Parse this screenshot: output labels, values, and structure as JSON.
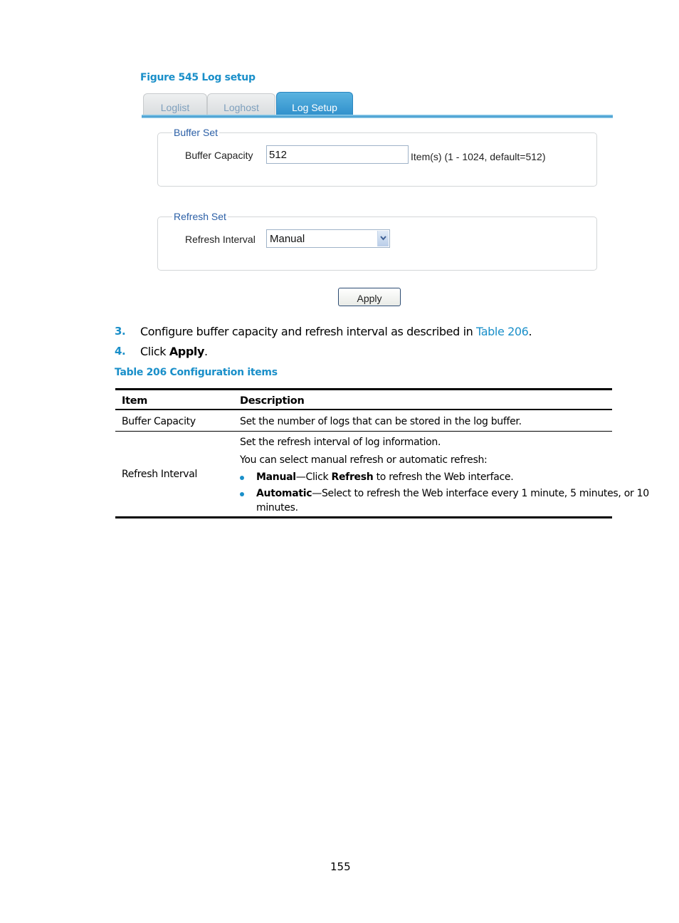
{
  "figure": {
    "caption": "Figure 545 Log setup",
    "tabs": [
      {
        "label": "Loglist",
        "active": false
      },
      {
        "label": "Loghost",
        "active": false
      },
      {
        "label": "Log Setup",
        "active": true
      }
    ],
    "buffer_set": {
      "legend": "Buffer Set",
      "field_label": "Buffer Capacity",
      "value": "512",
      "hint": "Item(s) (1 - 1024, default=512)"
    },
    "refresh_set": {
      "legend": "Refresh Set",
      "field_label": "Refresh Interval",
      "selected": "Manual",
      "arrow_icon": "chevron-down-icon"
    },
    "apply_label": "Apply"
  },
  "steps": [
    {
      "num": "3.",
      "text_before": "Configure buffer capacity and refresh interval as described in ",
      "link": "Table 206",
      "text_after": "."
    },
    {
      "num": "4.",
      "text_before": "Click ",
      "bold": "Apply",
      "text_after": "."
    }
  ],
  "table": {
    "caption": "Table 206 Configuration items",
    "headers": [
      "Item",
      "Description"
    ],
    "rows": [
      {
        "item": "Buffer Capacity",
        "description": [
          "Set the number of logs that can be stored in the log buffer."
        ]
      },
      {
        "item": "Refresh Interval",
        "description": [
          "Set the refresh interval of log information.",
          "You can select manual refresh or automatic refresh:"
        ],
        "bullets": [
          {
            "bold": "Manual",
            "text1": "—Click ",
            "bold2": "Refresh",
            "text2": " to refresh the Web interface."
          },
          {
            "bold": "Automatic",
            "text1": "—Select to refresh the Web interface every 1 minute, 5 minutes, or 10",
            "continuation": "minutes."
          }
        ]
      }
    ]
  },
  "colors": {
    "accent": "#1a8fc9",
    "tab_active": "#3f9fd6",
    "legend": "#2b5fa6"
  },
  "page_number": "155"
}
